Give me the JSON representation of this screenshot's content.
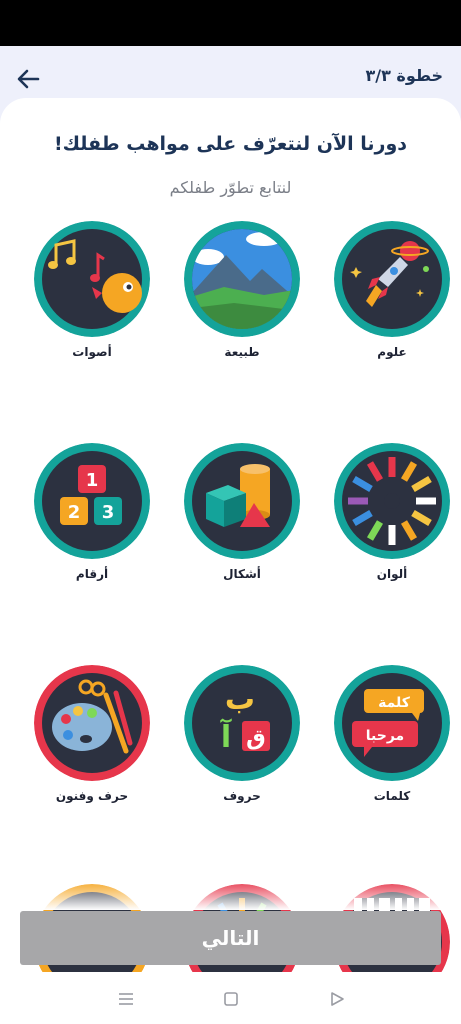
{
  "header": {
    "step": "خطوة ٣/٣"
  },
  "title": "دورنا الآن لنتعرّف على مواهب طفلك!",
  "subtitle": "لنتابع تطوّر طفلكم",
  "categories": [
    {
      "label": "علوم",
      "icon": "rocket-planet-icon",
      "ring": "#14a39a"
    },
    {
      "label": "طبيعة",
      "icon": "mountain-landscape-icon",
      "ring": "#14a39a"
    },
    {
      "label": "أصوات",
      "icon": "music-notes-bird-icon",
      "ring": "#14a39a"
    },
    {
      "label": "ألوان",
      "icon": "color-wheel-icon",
      "ring": "#14a39a"
    },
    {
      "label": "أشكال",
      "icon": "shapes-3d-icon",
      "ring": "#14a39a"
    },
    {
      "label": "أرقام",
      "icon": "number-blocks-icon",
      "ring": "#14a39a"
    },
    {
      "label": "كلمات",
      "icon": "word-bubbles-icon",
      "ring": "#14a39a"
    },
    {
      "label": "حروف",
      "icon": "arabic-letters-icon",
      "ring": "#14a39a"
    },
    {
      "label": "حرف وفنون",
      "icon": "paint-palette-icon",
      "ring": "#e6364b"
    }
  ],
  "letters_icon": {
    "top": "ب",
    "left": "آ",
    "right": "ق"
  },
  "words_icon": {
    "top": "كلمة",
    "bottom": "مرحبا"
  },
  "numbers_icon": {
    "top": "1",
    "left": "2",
    "right": "3"
  },
  "next_button": {
    "label": "التالي"
  },
  "colors": {
    "accent": "#14a39a",
    "red_ring": "#e6364b",
    "dark_fill": "#2c3140",
    "title": "#1d3457",
    "button_disabled": "#a7a7a9"
  }
}
